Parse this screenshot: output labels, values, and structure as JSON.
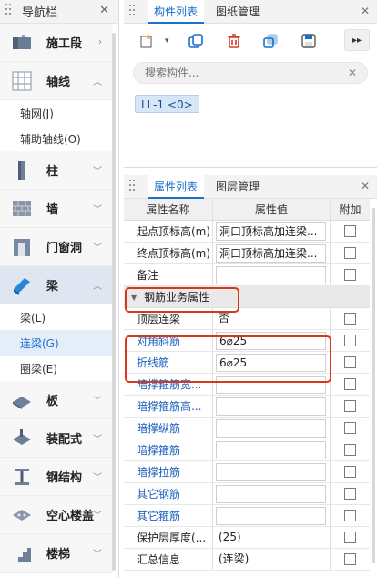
{
  "nav": {
    "title": "导航栏",
    "categories": [
      {
        "label": "施工段",
        "icon": "construction-stage-icon",
        "chevron": "›"
      },
      {
        "label": "轴线",
        "icon": "grid-axis-icon",
        "chevron": "⌃"
      },
      {
        "label": "柱",
        "icon": "column-icon",
        "chevron": "⌄"
      },
      {
        "label": "墙",
        "icon": "wall-icon",
        "chevron": "⌄"
      },
      {
        "label": "门窗洞",
        "icon": "door-window-icon",
        "chevron": "⌄"
      },
      {
        "label": "梁",
        "icon": "beam-icon",
        "chevron": "⌃"
      },
      {
        "label": "板",
        "icon": "slab-icon",
        "chevron": "⌄"
      },
      {
        "label": "装配式",
        "icon": "prefab-icon",
        "chevron": "⌄"
      },
      {
        "label": "钢结构",
        "icon": "steel-structure-icon",
        "chevron": "⌄"
      },
      {
        "label": "空心楼盖",
        "icon": "hollow-floor-icon",
        "chevron": "⌄"
      },
      {
        "label": "楼梯",
        "icon": "stair-icon",
        "chevron": "⌄"
      }
    ],
    "axis_items": [
      "轴网(J)",
      "辅助轴线(O)"
    ],
    "beam_items": [
      "梁(L)",
      "连梁(G)",
      "圈梁(E)"
    ]
  },
  "component_panel": {
    "tabs": [
      "构件列表",
      "图纸管理"
    ],
    "search_placeholder": "搜索构件...",
    "component": "LL-1 <0>"
  },
  "property_panel": {
    "tabs": [
      "属性列表",
      "图层管理"
    ],
    "headers": {
      "name": "属性名称",
      "value": "属性值",
      "add": "附加"
    },
    "rows_top": [
      {
        "name": "起点顶标高(m)",
        "value": "洞口顶标高加连梁..."
      },
      {
        "name": "终点顶标高(m)",
        "value": "洞口顶标高加连梁..."
      },
      {
        "name": "备注",
        "value": ""
      }
    ],
    "group_title": "钢筋业务属性",
    "rows_rebar": [
      {
        "name": "顶层连梁",
        "value": "否"
      },
      {
        "name": "对角斜筋",
        "value": "6⌀25"
      },
      {
        "name": "折线筋",
        "value": "6⌀25"
      },
      {
        "name": "暗撑箍筋宽...",
        "value": ""
      },
      {
        "name": "暗撑箍筋高...",
        "value": ""
      },
      {
        "name": "暗撑纵筋",
        "value": ""
      },
      {
        "name": "暗撑箍筋",
        "value": ""
      },
      {
        "name": "暗撑拉筋",
        "value": ""
      },
      {
        "name": "其它钢筋",
        "value": ""
      },
      {
        "name": "其它箍筋",
        "value": ""
      },
      {
        "name": "保护层厚度(...",
        "value": "(25)"
      },
      {
        "name": "汇总信息",
        "value": "(连梁)"
      }
    ]
  },
  "colors": {
    "accent": "#1a6fcf",
    "highlight": "#d9361c",
    "blue_label": "#1a5fbf"
  }
}
